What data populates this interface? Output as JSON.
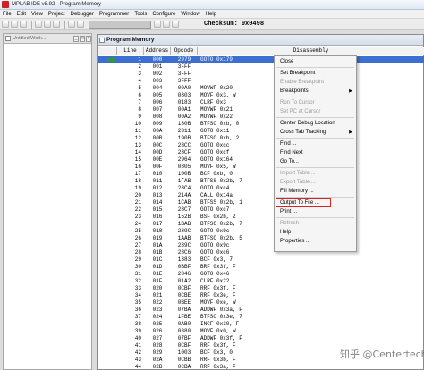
{
  "window": {
    "title": "MPLAB IDE v8.92 - Program Memory"
  },
  "menu": [
    "File",
    "Edit",
    "View",
    "Project",
    "Debugger",
    "Programmer",
    "Tools",
    "Configure",
    "Window",
    "Help"
  ],
  "toolbar": {
    "checksum_label": "Checksum:",
    "checksum_value": "0x0498"
  },
  "workspace": {
    "title": "Untitled Work..."
  },
  "program_memory": {
    "title": "Program Memory",
    "columns": [
      "Line",
      "Address",
      "Opcode",
      "Disassembly"
    ],
    "rows": [
      {
        "line": "1",
        "addr": "000",
        "op": "2979",
        "dis": "GOTO 0x179"
      },
      {
        "line": "2",
        "addr": "001",
        "op": "3FFF",
        "dis": ""
      },
      {
        "line": "3",
        "addr": "002",
        "op": "3FFF",
        "dis": ""
      },
      {
        "line": "4",
        "addr": "003",
        "op": "3FFF",
        "dis": ""
      },
      {
        "line": "5",
        "addr": "004",
        "op": "00A0",
        "dis": "MOVWF 0x20"
      },
      {
        "line": "6",
        "addr": "005",
        "op": "0803",
        "dis": "MOVF 0x3, W"
      },
      {
        "line": "7",
        "addr": "006",
        "op": "0183",
        "dis": "CLRF 0x3"
      },
      {
        "line": "8",
        "addr": "007",
        "op": "00A1",
        "dis": "MOVWF 0x21"
      },
      {
        "line": "9",
        "addr": "008",
        "op": "00A2",
        "dis": "MOVWF 0x22"
      },
      {
        "line": "10",
        "addr": "009",
        "op": "180B",
        "dis": "BTFSC 0xb, 0"
      },
      {
        "line": "11",
        "addr": "00A",
        "op": "2811",
        "dis": "GOTO 0x11"
      },
      {
        "line": "12",
        "addr": "00B",
        "op": "190B",
        "dis": "BTFSC 0xb, 2"
      },
      {
        "line": "13",
        "addr": "00C",
        "op": "28CC",
        "dis": "GOTO 0xcc"
      },
      {
        "line": "14",
        "addr": "00D",
        "op": "28CF",
        "dis": "GOTO 0xcf"
      },
      {
        "line": "15",
        "addr": "00E",
        "op": "2964",
        "dis": "GOTO 0x164"
      },
      {
        "line": "16",
        "addr": "00F",
        "op": "0805",
        "dis": "MOVF 0x5, W"
      },
      {
        "line": "17",
        "addr": "010",
        "op": "100B",
        "dis": "BCF 0xb, 0"
      },
      {
        "line": "18",
        "addr": "011",
        "op": "1FAB",
        "dis": "BTFSS 0x2b, 7"
      },
      {
        "line": "19",
        "addr": "012",
        "op": "28C4",
        "dis": "GOTO 0xc4"
      },
      {
        "line": "20",
        "addr": "013",
        "op": "214A",
        "dis": "CALL 0x14a"
      },
      {
        "line": "21",
        "addr": "014",
        "op": "1CAB",
        "dis": "BTFSS 0x2b, 1"
      },
      {
        "line": "22",
        "addr": "015",
        "op": "28C7",
        "dis": "GOTO 0xc7"
      },
      {
        "line": "23",
        "addr": "016",
        "op": "152B",
        "dis": "BSF 0x2b, 2"
      },
      {
        "line": "24",
        "addr": "017",
        "op": "1BAB",
        "dis": "BTFSC 0x2b, 7"
      },
      {
        "line": "25",
        "addr": "018",
        "op": "289C",
        "dis": "GOTO 0x9c"
      },
      {
        "line": "26",
        "addr": "019",
        "op": "1AAB",
        "dis": "BTFSC 0x2b, 5"
      },
      {
        "line": "27",
        "addr": "01A",
        "op": "289C",
        "dis": "GOTO 0x9c"
      },
      {
        "line": "28",
        "addr": "01B",
        "op": "28C6",
        "dis": "GOTO 0xc6"
      },
      {
        "line": "29",
        "addr": "01C",
        "op": "1383",
        "dis": "BCF 0x3, 7"
      },
      {
        "line": "30",
        "addr": "01D",
        "op": "0BBF",
        "dis": "BRF 0x3f, F"
      },
      {
        "line": "31",
        "addr": "01E",
        "op": "2846",
        "dis": "GOTO 0x46"
      },
      {
        "line": "32",
        "addr": "01F",
        "op": "01A2",
        "dis": "CLRF 0x22"
      },
      {
        "line": "33",
        "addr": "020",
        "op": "0CBF",
        "dis": "RRF 0x3f, F"
      },
      {
        "line": "34",
        "addr": "021",
        "op": "0CBE",
        "dis": "RRF 0x3e, F"
      },
      {
        "line": "35",
        "addr": "022",
        "op": "0BEE",
        "dis": "MOVF 0xe, W"
      },
      {
        "line": "36",
        "addr": "023",
        "op": "07BA",
        "dis": "ADDWF 0x3a, F"
      },
      {
        "line": "37",
        "addr": "024",
        "op": "1FBE",
        "dis": "BTFSC 0x3e, 7"
      },
      {
        "line": "38",
        "addr": "025",
        "op": "0AB0",
        "dis": "INCF 0x30, F"
      },
      {
        "line": "39",
        "addr": "026",
        "op": "0880",
        "dis": "MOVF 0x0, W"
      },
      {
        "line": "40",
        "addr": "027",
        "op": "07BF",
        "dis": "ADDWF 0x3f, F"
      },
      {
        "line": "41",
        "addr": "028",
        "op": "0CBF",
        "dis": "RRF 0x3f, F"
      },
      {
        "line": "42",
        "addr": "029",
        "op": "1003",
        "dis": "BCF 0x3, 0"
      },
      {
        "line": "43",
        "addr": "02A",
        "op": "0CBB",
        "dis": "RRF 0x3b, F"
      },
      {
        "line": "44",
        "addr": "02B",
        "op": "0CBA",
        "dis": "RRF 0x3a, F"
      },
      {
        "line": "45",
        "addr": "02C",
        "op": "0BA1",
        "dis": "DECF 0x21, F"
      },
      {
        "line": "46",
        "addr": "02D",
        "op": "00BA",
        "dis": "MOVWF 0x3a"
      }
    ]
  },
  "context_menu": {
    "items": [
      {
        "label": "Close",
        "disabled": false,
        "submenu": false,
        "highlight": false,
        "sep_after": true
      },
      {
        "label": "Set Breakpoint",
        "disabled": false,
        "submenu": false,
        "highlight": false,
        "sep_after": false
      },
      {
        "label": "Enable Breakpoint",
        "disabled": true,
        "submenu": false,
        "highlight": false,
        "sep_after": false
      },
      {
        "label": "Breakpoints",
        "disabled": false,
        "submenu": true,
        "highlight": false,
        "sep_after": true
      },
      {
        "label": "Run To Cursor",
        "disabled": true,
        "submenu": false,
        "highlight": false,
        "sep_after": false
      },
      {
        "label": "Set PC at Cursor",
        "disabled": true,
        "submenu": false,
        "highlight": false,
        "sep_after": true
      },
      {
        "label": "Center Debug Location",
        "disabled": false,
        "submenu": false,
        "highlight": false,
        "sep_after": false
      },
      {
        "label": "Cross Tab Tracking",
        "disabled": false,
        "submenu": true,
        "highlight": false,
        "sep_after": true
      },
      {
        "label": "Find ...",
        "disabled": false,
        "submenu": false,
        "highlight": false,
        "sep_after": false
      },
      {
        "label": "Find Next",
        "disabled": false,
        "submenu": false,
        "highlight": false,
        "sep_after": false
      },
      {
        "label": "Go To...",
        "disabled": false,
        "submenu": false,
        "highlight": false,
        "sep_after": true
      },
      {
        "label": "Import Table ...",
        "disabled": true,
        "submenu": false,
        "highlight": false,
        "sep_after": false
      },
      {
        "label": "Export Table ...",
        "disabled": true,
        "submenu": false,
        "highlight": false,
        "sep_after": false
      },
      {
        "label": "Fill Memory ...",
        "disabled": false,
        "submenu": false,
        "highlight": false,
        "sep_after": true
      },
      {
        "label": "Output To File ...",
        "disabled": false,
        "submenu": false,
        "highlight": true,
        "sep_after": false
      },
      {
        "label": "Print ...",
        "disabled": false,
        "submenu": false,
        "highlight": false,
        "sep_after": true
      },
      {
        "label": "Refresh",
        "disabled": true,
        "submenu": false,
        "highlight": false,
        "sep_after": false
      },
      {
        "label": "Help",
        "disabled": false,
        "submenu": false,
        "highlight": false,
        "sep_after": false
      },
      {
        "label": "Properties ...",
        "disabled": false,
        "submenu": false,
        "highlight": false,
        "sep_after": false
      }
    ]
  },
  "watermark": "知乎 @Centertech",
  "colors": {
    "current_row": "#3c6fd0",
    "pc_arrow": "#2e9e2e",
    "highlight_border": "#d22222"
  }
}
